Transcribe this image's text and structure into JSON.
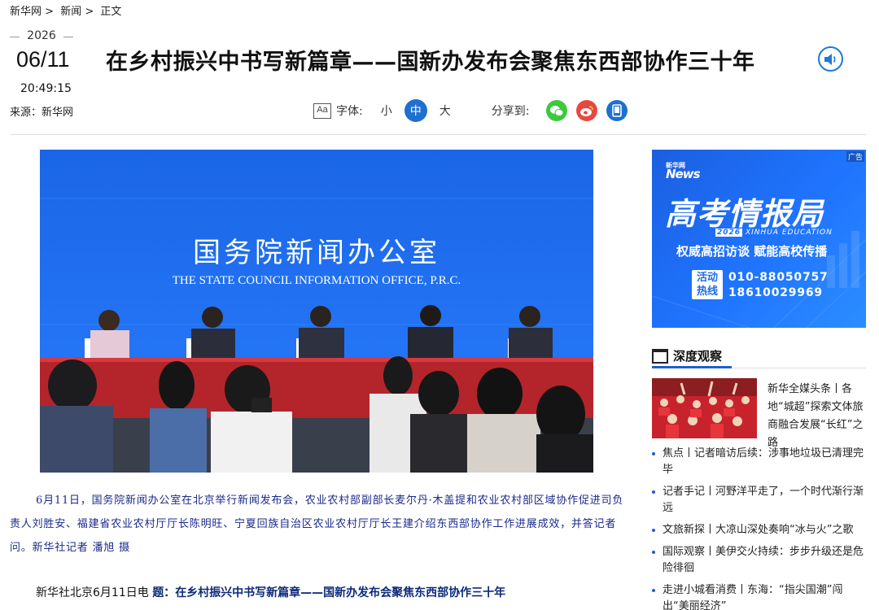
{
  "breadcrumb": {
    "home": "新华网",
    "sep": ">",
    "section": "新闻",
    "current": "正文"
  },
  "article": {
    "year": "2026",
    "date": "06/11",
    "time": "20:49:15",
    "source": "来源：新华网",
    "title": "在乡村振兴中书写新篇章——国新办发布会聚焦东西部协作三十年",
    "caption": "6月11日，国务院新闻办公室在北京举行新闻发布会，农业农村部副部长麦尔丹·木盖提和农业农村部区域协作促进司负责人刘胜安、福建省农业农村厅厅长陈明旺、宁夏回族自治区农业农村厅厅长王建介绍东西部协作工作进展成效，并答记者问。新华社记者 潘旭 摄",
    "dateline_prefix": "新华社北京6月11日电",
    "dateline_label": "题：",
    "dateline_title": "在乡村振兴中书写新篇章——国新办发布会聚焦东西部协作三十年"
  },
  "toolbar": {
    "font_icon": "Aa",
    "font_label": "字体:",
    "sizes": [
      "小",
      "中",
      "大"
    ],
    "active_size": "中",
    "share_label": "分享到:",
    "share_icons": [
      "wechat-icon",
      "weibo-icon",
      "mobile-icon"
    ]
  },
  "photo": {
    "backdrop_cn": "国务院新闻办公室",
    "backdrop_en": "THE STATE COUNCIL INFORMATION OFFICE, P.R.C."
  },
  "ad": {
    "tag": "广告",
    "logo_top": "新华网",
    "logo_big": "News",
    "title": "高考情报局",
    "sub_year": "2026",
    "sub_text": "XINHUA EDUCATION",
    "slogan": "权威高招访谈 赋能高校传播",
    "hot_label_1": "活动",
    "hot_label_2": "热线",
    "phone_1": "010-88050757",
    "phone_2": "18610029969"
  },
  "sidebar": {
    "section_title": "深度观察",
    "feature_text": "新华全媒头条丨各地“城超”探索文体旅商融合发展“长红”之路",
    "news": [
      "焦点丨记者暗访后续：涉事地垃圾已清理完毕",
      "记者手记丨河野洋平走了，一个时代渐行渐远",
      "文旅新探丨大凉山深处奏响“冰与火”之歌",
      "国际观察丨美伊交火持续：步步升级还是危险徘徊",
      "走进小城看消费丨东海：“指尖国潮”闯出“美丽经济”"
    ]
  },
  "colors": {
    "accent": "#1e6fd0",
    "caption_text": "#1a2a8a",
    "ad_bg": "#1f6ee8",
    "wechat": "#3cc93c",
    "weibo": "#e8473f",
    "mobile": "#1e6fd0"
  }
}
